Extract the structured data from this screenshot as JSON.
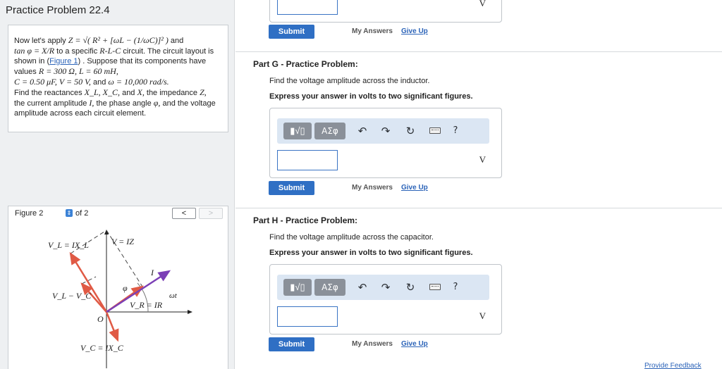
{
  "left": {
    "title": "Practice Problem 22.4",
    "problem": {
      "p1": "Now let's apply ",
      "eq1": "Z = √( R² + [ωL − (1/ωC)]² )",
      "p2": " and ",
      "eq2": "tan φ = X/R",
      "p3": " to a specific ",
      "eq3": "R-L-C",
      "p4": " circuit. The circuit layout is shown in (",
      "link": "Figure 1",
      "p5": ") . Suppose that its components have values ",
      "eq4": "R = 300 Ω, L = 60 mH,",
      "eq5": "C = 0.50 μF, V = 50 V,",
      "p6": " and ",
      "eq6": "ω = 10,000 rad/s.",
      "p7": "Find the reactances ",
      "eq7": "X_L, X_C,",
      "p8": " and ",
      "eq8": "X,",
      "p9": " the impedance ",
      "eq9": "Z,",
      "p10": " the current amplitude ",
      "eq10": "I,",
      "p11": " the phase angle ",
      "eq11": "φ,",
      "p12": " and the voltage amplitude across each circuit element."
    },
    "figure": {
      "label": "Figure 2",
      "of": "of 2",
      "prev": "<",
      "next": ">",
      "labels": {
        "vl": "V_L = IX_L",
        "v": "V = IZ",
        "i": "I",
        "phi": "φ",
        "wt": "ωt",
        "vlvc": "V_L − V_C",
        "vr": "V_R = IR",
        "o": "O",
        "vc": "V_C = IX_C"
      }
    }
  },
  "right": {
    "unit": "V",
    "submit": "Submit",
    "my_answers": "My Answers",
    "give_up": "Give Up",
    "toolbar": {
      "templates": "▮√▯",
      "symbols": "ΑΣφ",
      "undo": "↶",
      "redo": "↷",
      "reset": "↻",
      "help": "?"
    },
    "part_g": {
      "title": "Part G - Practice Problem:",
      "question": "Find the voltage amplitude across the inductor.",
      "express": "Express your answer in volts to two significant figures."
    },
    "part_h": {
      "title": "Part H - Practice Problem:",
      "question": "Find the voltage amplitude across the capacitor.",
      "express": "Express your answer in volts to two significant figures."
    },
    "feedback": "Provide Feedback"
  },
  "colors": {
    "accent": "#2f6fc4",
    "link": "#2b63b8",
    "toolbar": "#dbe6f3",
    "phasor_red": "#e05a45",
    "phasor_purple": "#7b3fb6"
  }
}
